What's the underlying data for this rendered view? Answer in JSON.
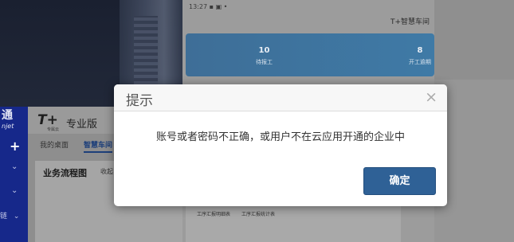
{
  "phone": {
    "status_time": "13:27",
    "status_icons": "▪ ▣ •",
    "title": "T+智慧车间",
    "stats": [
      {
        "value": "10",
        "label": "待报工"
      },
      {
        "value": "8",
        "label": "开工逾期"
      }
    ],
    "bottom_items": [
      "工序汇报明细表",
      "工序汇报统计表"
    ]
  },
  "left_app": {
    "rail_logo_main": "通",
    "rail_logo_sub": "njet",
    "plus": "+",
    "rail_bottom_text": "链",
    "logo": "T+",
    "logo_sub": "专属云",
    "edition": "专业版",
    "tabs": [
      "我的桌面",
      "智慧车间"
    ],
    "content_title": "业务流程图",
    "content_collapse": "收起"
  },
  "modal": {
    "title": "提示",
    "close": "×",
    "message": "账号或者密码不正确，或用户不在云应用开通的企业中",
    "ok_label": "确定"
  }
}
